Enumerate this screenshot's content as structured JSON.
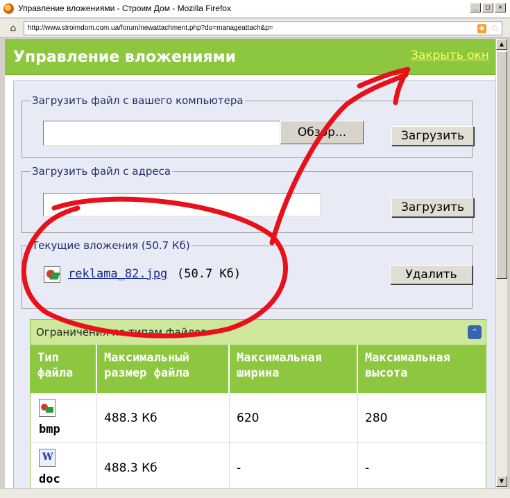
{
  "window": {
    "title": "Управление вложениями - Строим Дом - Mozilla Firefox",
    "minimize_glyph": "_",
    "maximize_glyph": "□",
    "close_glyph": "✕"
  },
  "addressbar": {
    "url": "http://www.stroimdom.com.ua/forum/newattachment.php?do=manageattach&p="
  },
  "header": {
    "title": "Управление вложениями",
    "close_link": "Закрыть окн"
  },
  "upload_local": {
    "legend": "Загрузить файл с вашего компьютера",
    "browse_label": "Обзор...",
    "upload_label": "Загрузить"
  },
  "upload_url": {
    "legend": "Загрузить файл с адреса",
    "upload_label": "Загрузить"
  },
  "current": {
    "legend": "Текущие вложения (50.7 Кб)",
    "file_name": "reklama_82.jpg",
    "file_size": "(50.7 Кб)",
    "delete_label": "Удалить"
  },
  "limits": {
    "title": "Ограничения по типам файлов",
    "columns": [
      "Тип файла",
      "Максимальный размер файла",
      "Максимальная ширина",
      "Максимальная высота"
    ],
    "rows": [
      {
        "type": "bmp",
        "icon": "bmp-file-icon",
        "size": "488.3 Кб",
        "width": "620",
        "height": "280"
      },
      {
        "type": "doc",
        "icon": "doc-file-icon",
        "size": "488.3 Кб",
        "width": "-",
        "height": "-"
      }
    ]
  },
  "annotation": {
    "color": "#e8101a",
    "shapes": [
      "red-ellipse-around-current-attachments",
      "red-arrow-to-close-link"
    ]
  },
  "colors": {
    "header_green": "#8dc63f",
    "panel_bg": "#e8ebf5",
    "link_yellow": "#ffff66",
    "legend_blue": "#1f2b6a"
  }
}
